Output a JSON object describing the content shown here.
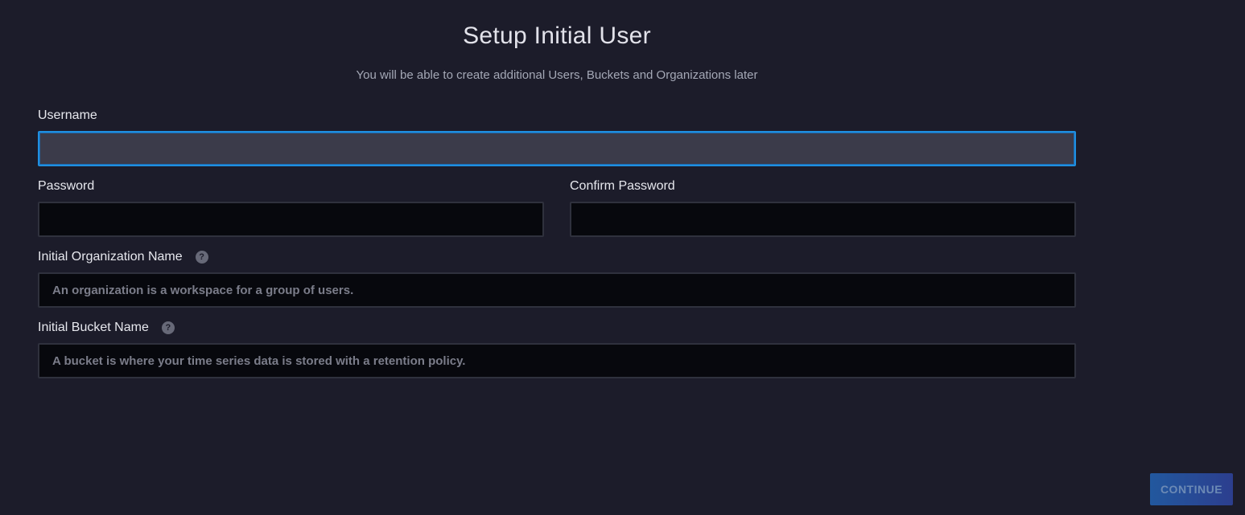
{
  "header": {
    "title": "Setup Initial User",
    "subtitle": "You will be able to create additional Users, Buckets and Organizations later"
  },
  "form": {
    "username": {
      "label": "Username",
      "value": "",
      "placeholder": ""
    },
    "password": {
      "label": "Password",
      "value": "",
      "placeholder": ""
    },
    "confirm_password": {
      "label": "Confirm Password",
      "value": "",
      "placeholder": ""
    },
    "org_name": {
      "label": "Initial Organization Name",
      "value": "",
      "placeholder": "An organization is a workspace for a group of users.",
      "help_icon": "question-circle-icon"
    },
    "bucket_name": {
      "label": "Initial Bucket Name",
      "value": "",
      "placeholder": "A bucket is where your time series data is stored with a retention policy.",
      "help_icon": "question-circle-icon"
    }
  },
  "actions": {
    "continue_label": "CONTINUE"
  },
  "colors": {
    "background": "#1c1c2a",
    "input_background": "#07080d",
    "focus_border": "#1f8fe0",
    "button_gradient_start": "#22589e",
    "button_gradient_end": "#2c3e8e"
  }
}
